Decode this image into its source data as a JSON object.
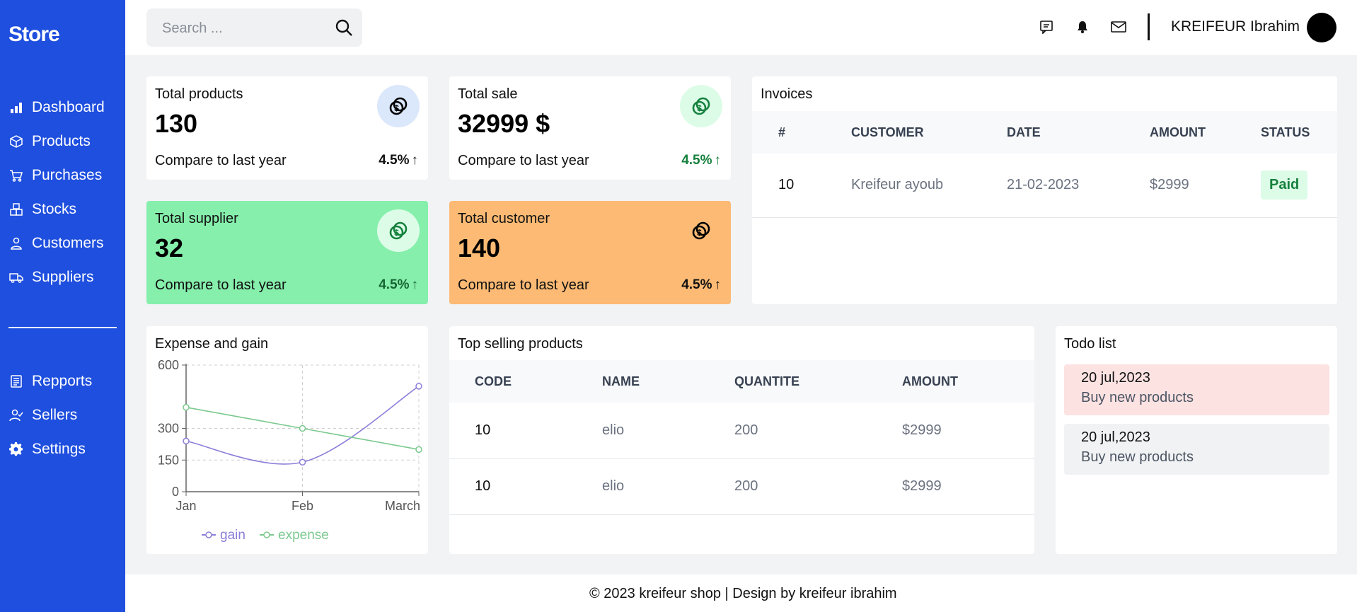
{
  "sidebar": {
    "brand": "Store",
    "items": [
      {
        "label": "Dashboard",
        "icon": "bar-chart-icon"
      },
      {
        "label": "Products",
        "icon": "box-icon"
      },
      {
        "label": "Purchases",
        "icon": "cart-icon"
      },
      {
        "label": "Stocks",
        "icon": "boxes-icon"
      },
      {
        "label": "Customers",
        "icon": "person-icon"
      },
      {
        "label": "Suppliers",
        "icon": "truck-icon"
      }
    ],
    "items2": [
      {
        "label": "Repports",
        "icon": "report-icon"
      },
      {
        "label": "Sellers",
        "icon": "person-check-icon"
      },
      {
        "label": "Settings",
        "icon": "gear-icon"
      }
    ]
  },
  "header": {
    "search_placeholder": "Search ...",
    "username": "KREIFEUR Ibrahim"
  },
  "stats": [
    {
      "label": "Total products",
      "value": "130",
      "compare": "Compare to last year",
      "pct": "4.5%",
      "bg": "#ffffff",
      "coin_bg": "#dbe7fb",
      "coin_color": "#000000",
      "pct_color": "#111111"
    },
    {
      "label": "Total sale",
      "value": "32999 $",
      "compare": "Compare to last year",
      "pct": "4.5%",
      "bg": "#ffffff",
      "coin_bg": "#dcfce7",
      "coin_color": "#15803d",
      "pct_color": "#15803d"
    },
    {
      "label": "Total supplier",
      "value": "32",
      "compare": "Compare to last year",
      "pct": "4.5%",
      "bg": "#86efac",
      "coin_bg": "#dcfce7",
      "coin_color": "#15803d",
      "pct_color": "#166534"
    },
    {
      "label": "Total customer",
      "value": "140",
      "compare": "Compare to last year",
      "pct": "4.5%",
      "bg": "#fdba74",
      "coin_bg": "#fdba74",
      "coin_color": "#000000",
      "pct_color": "#111111"
    }
  ],
  "invoices": {
    "title": "Invoices",
    "columns": [
      "#",
      "CUSTOMER",
      "DATE",
      "AMOUNT",
      "STATUS"
    ],
    "rows": [
      {
        "id": "10",
        "customer": "Kreifeur ayoub",
        "date": "21-02-2023",
        "amount": "$2999",
        "status": "Paid"
      }
    ]
  },
  "expense_chart": {
    "title": "Expense and gain"
  },
  "chart_data": {
    "type": "line",
    "title": "Expense and gain",
    "x": [
      "Jan",
      "Feb",
      "March"
    ],
    "yticks": [
      0,
      150,
      300,
      600
    ],
    "ylim": [
      0,
      600
    ],
    "series": [
      {
        "name": "gain",
        "values": [
          240,
          140,
          500
        ],
        "color": "#8b7fd9"
      },
      {
        "name": "expense",
        "values": [
          400,
          300,
          200
        ],
        "color": "#7cc98f"
      }
    ],
    "legend": "bottom",
    "grid": true
  },
  "top_products": {
    "title": "Top selling products",
    "columns": [
      "CODE",
      "NAME",
      "QUANTITE",
      "AMOUNT"
    ],
    "rows": [
      {
        "code": "10",
        "name": "elio",
        "qty": "200",
        "amount": "$2999"
      },
      {
        "code": "10",
        "name": "elio",
        "qty": "200",
        "amount": "$2999"
      }
    ]
  },
  "todo": {
    "title": "Todo list",
    "items": [
      {
        "date": "20 jul,2023",
        "text": "Buy new products",
        "bg": "#fde2e2"
      },
      {
        "date": "20 jul,2023",
        "text": "Buy new products",
        "bg": "#f1f2f4"
      }
    ]
  },
  "footer": "© 2023 kreifeur shop | Design by kreifeur ibrahim"
}
